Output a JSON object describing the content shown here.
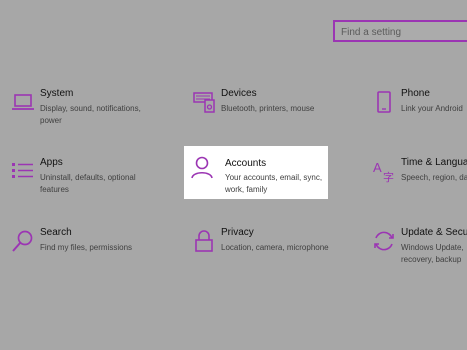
{
  "search": {
    "placeholder": "Find a setting"
  },
  "accent_color": "#9b35b3",
  "tiles": [
    {
      "title": "System",
      "desc": "Display, sound, notifications, power",
      "icon": "laptop-icon"
    },
    {
      "title": "Devices",
      "desc": "Bluetooth, printers, mouse",
      "icon": "keyboard-printer-icon"
    },
    {
      "title": "Phone",
      "desc": "Link your Android",
      "icon": "phone-icon"
    },
    {
      "title": "Apps",
      "desc": "Uninstall, defaults, optional features",
      "icon": "apps-list-icon"
    },
    {
      "title": "Accounts",
      "desc": "Your accounts, email, sync, work, family",
      "icon": "person-icon"
    },
    {
      "title": "Time & Language",
      "desc": "Speech, region, date",
      "icon": "time-language-icon"
    },
    {
      "title": "Search",
      "desc": "Find my files, permissions",
      "icon": "search-icon"
    },
    {
      "title": "Privacy",
      "desc": "Location, camera, microphone",
      "icon": "lock-icon"
    },
    {
      "title": "Update & Security",
      "desc": "Windows Update, recovery, backup",
      "icon": "sync-icon"
    }
  ]
}
